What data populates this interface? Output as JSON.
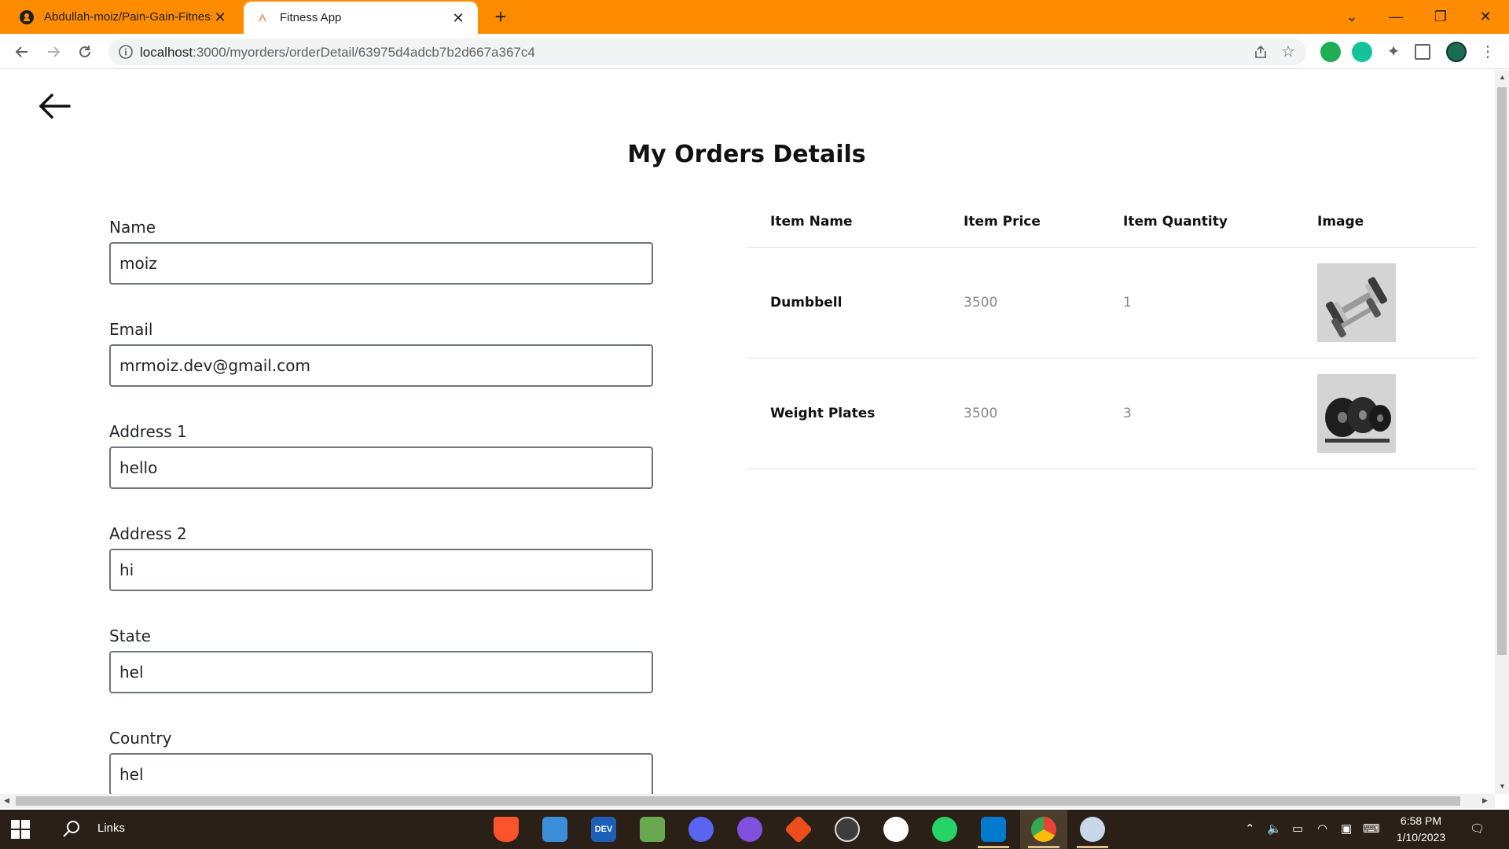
{
  "browser": {
    "tabs": [
      {
        "title": "Abdullah-moiz/Pain-Gain-Fitness",
        "active": false,
        "favicon": "github-icon"
      },
      {
        "title": "Fitness App",
        "active": true,
        "favicon": "app-favicon"
      }
    ],
    "new_tab_label": "+",
    "url_host": "localhost",
    "url_path": ":3000/myorders/orderDetail/63975d4adcb7b2d667a367c4",
    "accent_color": "#ff8c00"
  },
  "page": {
    "title": "My Orders Details",
    "form": {
      "name": {
        "label": "Name",
        "value": "moiz"
      },
      "email": {
        "label": "Email",
        "value": "mrmoiz.dev@gmail.com"
      },
      "address1": {
        "label": "Address 1",
        "value": "hello"
      },
      "address2": {
        "label": "Address 2",
        "value": "hi"
      },
      "state": {
        "label": "State",
        "value": "hel"
      },
      "country": {
        "label": "Country",
        "value": "hel"
      }
    },
    "table": {
      "headers": [
        "Item Name",
        "Item Price",
        "Item Quantity",
        "Image"
      ],
      "rows": [
        {
          "name": "Dumbbell",
          "price": "3500",
          "quantity": "1",
          "image": "dumbbell-image"
        },
        {
          "name": "Weight Plates",
          "price": "3500",
          "quantity": "3",
          "image": "weight-plates-image"
        }
      ]
    }
  },
  "taskbar": {
    "search_label": "Links",
    "time": "6:58 PM",
    "date": "1/10/2023",
    "background": "#2a2017"
  }
}
